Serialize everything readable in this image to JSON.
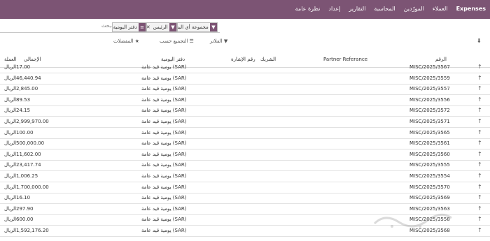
{
  "topbar": {
    "brand": "Expenses",
    "items": [
      "العملاء",
      "المورّدين",
      "المحاسبة",
      "التقارير",
      "إعداد",
      "نظرة عامة"
    ]
  },
  "search": {
    "placeholder": "بحث...",
    "facets": [
      {
        "label": "مجموعة أي البنك",
        "icon": "filter-icon"
      },
      {
        "label": "الرئيس",
        "icon": "filter-icon"
      },
      {
        "label": "دفتر اليومية",
        "icon": "stack-icon"
      }
    ]
  },
  "controls": {
    "filters": "الفلاتر",
    "group_by": "التجميع حسب",
    "favorites": "المفضلات"
  },
  "table": {
    "headers": {
      "checkbox": "",
      "reference": "الرقم",
      "partner_reference": "Partner Referance",
      "partner": "الشريك",
      "ref_number": "رقم الإشارة",
      "journal": "دفتر اليومية",
      "total": "الإجمالي",
      "currency": "العملة"
    },
    "rows": [
      {
        "check": "↑",
        "ref": "MISC/2025/3567",
        "journal": "يومية قيد عامة (SAR)",
        "amount": "17.00",
        "cur": "الريال"
      },
      {
        "check": "↑",
        "ref": "MISC/2025/3559",
        "journal": "يومية قيد عامة (SAR)",
        "amount": "46,440.94",
        "cur": "الريال"
      },
      {
        "check": "↑",
        "ref": "MISC/2025/3557",
        "journal": "يومية قيد عامة (SAR)",
        "amount": "2,845.00",
        "cur": "الريال"
      },
      {
        "check": "↑",
        "ref": "MISC/2025/3556",
        "journal": "يومية قيد عامة (SAR)",
        "amount": "89.53",
        "cur": "الريال"
      },
      {
        "check": "↑",
        "ref": "MISC/2025/3572",
        "journal": "يومية قيد عامة (SAR)",
        "amount": "24.15",
        "cur": "الريال"
      },
      {
        "check": "↑",
        "ref": "MISC/2025/3571",
        "journal": "يومية قيد عامة (SAR)",
        "amount": "2,999,970.00",
        "cur": "الريال"
      },
      {
        "check": "↑",
        "ref": "MISC/2025/3565",
        "journal": "يومية قيد عامة (SAR)",
        "amount": "100.00",
        "cur": "الريال"
      },
      {
        "check": "↑",
        "ref": "MISC/2025/3561",
        "journal": "يومية قيد عامة (SAR)",
        "amount": "500,000.00",
        "cur": "الريال"
      },
      {
        "check": "↑",
        "ref": "MISC/2025/3560",
        "journal": "يومية قيد عامة (SAR)",
        "amount": "11,602.00",
        "cur": "الريال"
      },
      {
        "check": "↑",
        "ref": "MISC/2025/3555",
        "journal": "يومية قيد عامة (SAR)",
        "amount": "23,417.74",
        "cur": "الريال"
      },
      {
        "check": "↑",
        "ref": "MISC/2025/3554",
        "journal": "يومية قيد عامة (SAR)",
        "amount": "1,006.25",
        "cur": "الريال"
      },
      {
        "check": "↑",
        "ref": "MISC/2025/3570",
        "journal": "يومية قيد عامة (SAR)",
        "amount": "1,700,000.00",
        "cur": "الريال"
      },
      {
        "check": "↑",
        "ref": "MISC/2025/3569",
        "journal": "يومية قيد عامة (SAR)",
        "amount": "16.10",
        "cur": "الريال"
      },
      {
        "check": "↑",
        "ref": "MISC/2025/3563",
        "journal": "يومية قيد عامة (SAR)",
        "amount": "297.90",
        "cur": "الريال"
      },
      {
        "check": "↑",
        "ref": "MISC/2025/3558",
        "journal": "يومية قيد عامة (SAR)",
        "amount": "600.00",
        "cur": "الريال"
      },
      {
        "check": "↑",
        "ref": "MISC/2025/3568",
        "journal": "يومية قيد عامة (SAR)",
        "amount": "1,592,176.20",
        "cur": "الريال"
      }
    ]
  },
  "colors": {
    "topbar": "#7c5474",
    "facet_icon": "#7c5474"
  }
}
